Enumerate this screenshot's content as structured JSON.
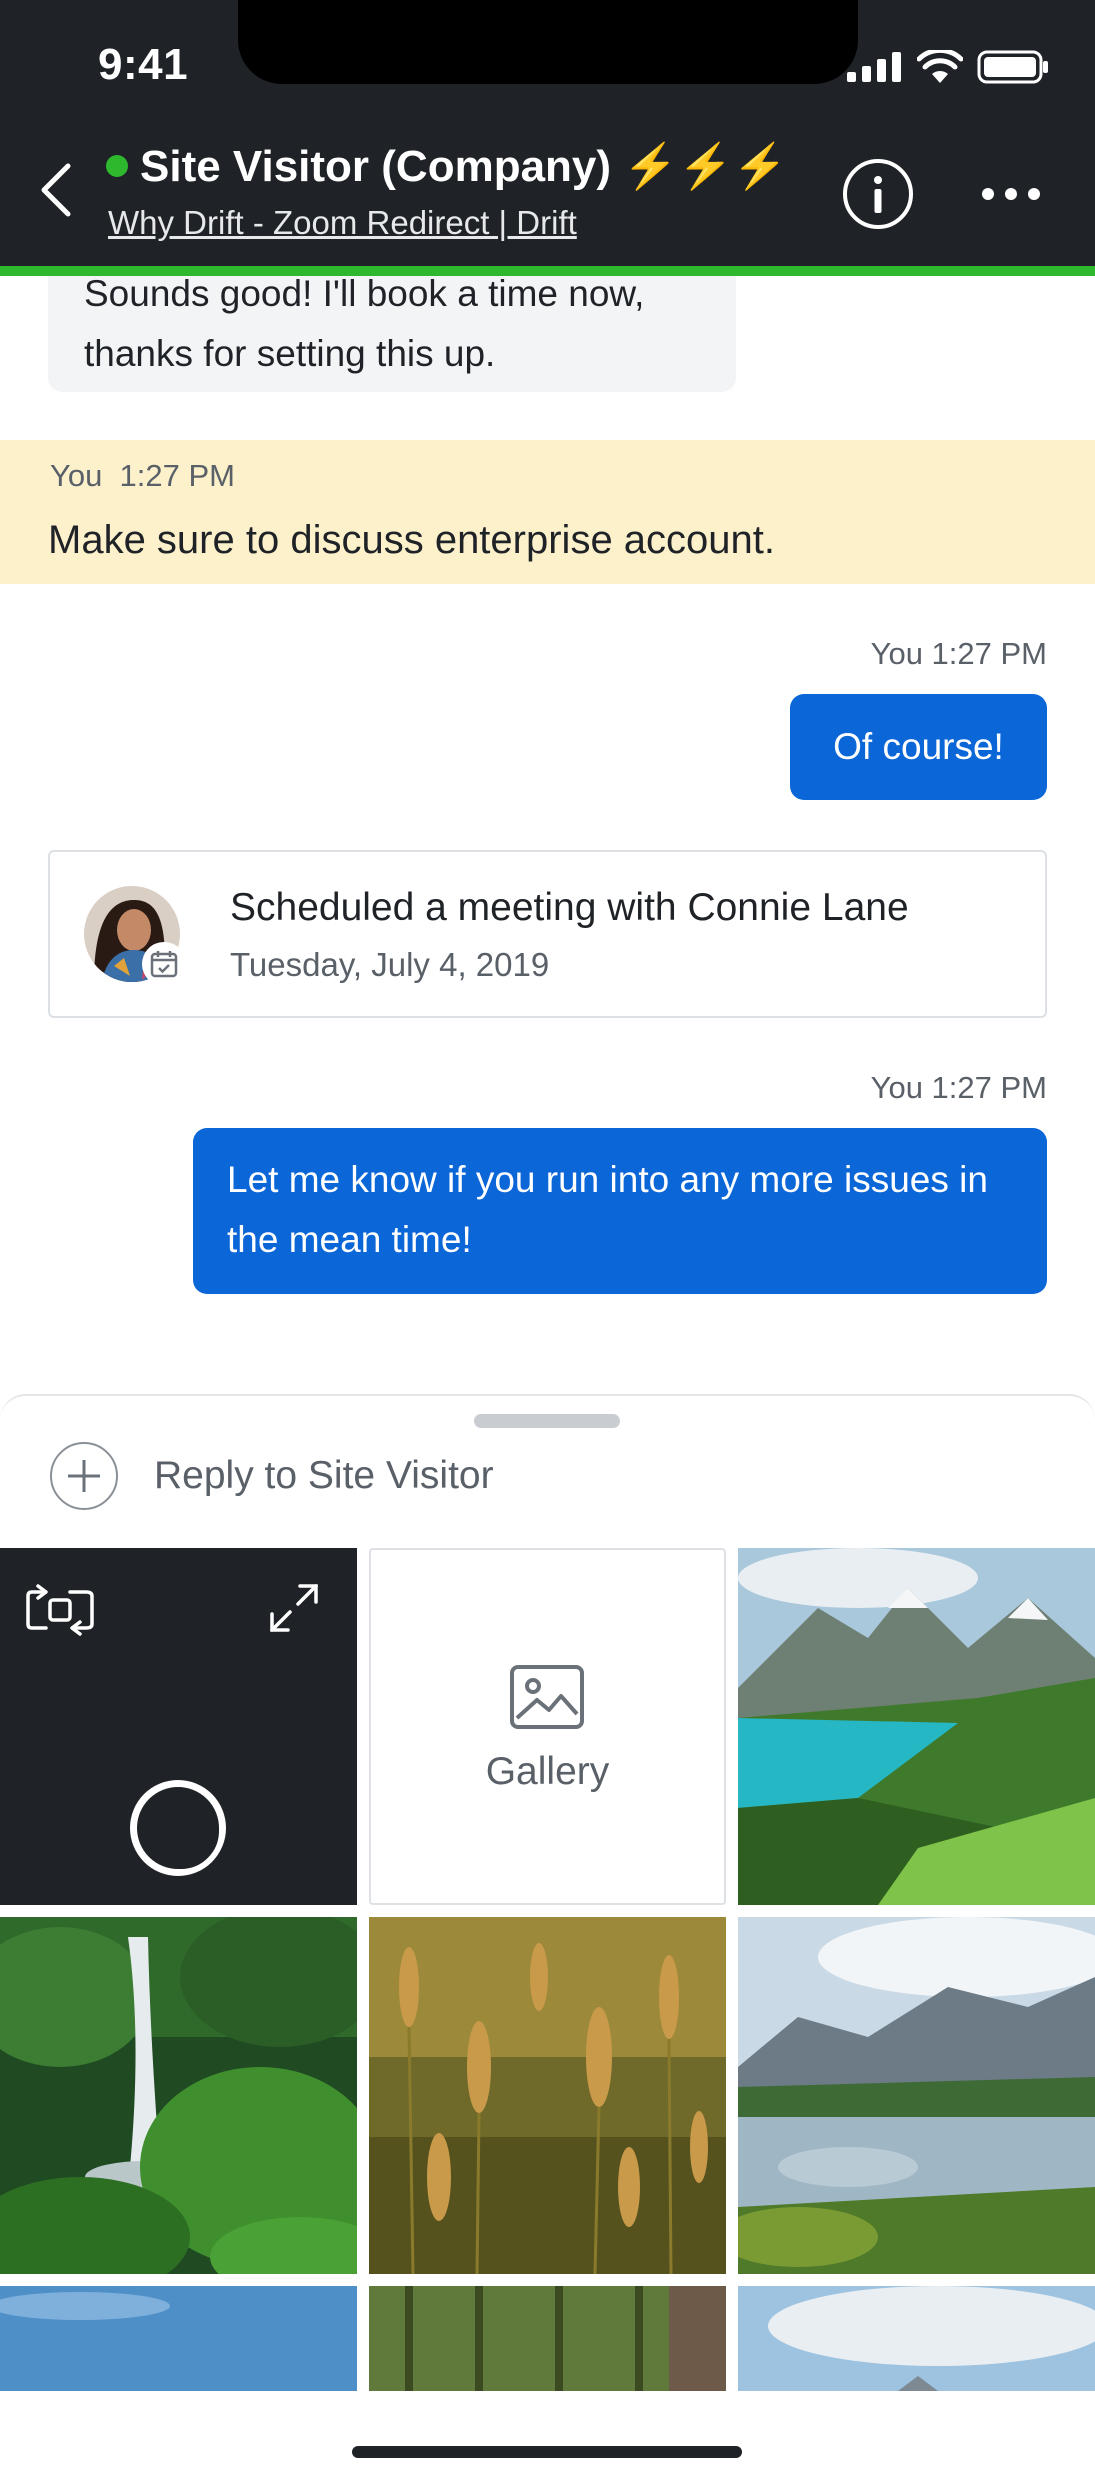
{
  "status_bar": {
    "time": "9:41"
  },
  "header": {
    "title": "Site Visitor (Company) ⚡⚡⚡",
    "subtitle": "Why Drift - Zoom Redirect | Drift",
    "online_color": "#2eb82e",
    "background_color": "#1f2327"
  },
  "messages": {
    "visitor_text": "Sounds good! I'll book a time now, thanks for setting this up.",
    "note": {
      "author": "You",
      "time": "1:27 PM",
      "text": "Make sure to discuss enterprise account."
    },
    "reply_1": {
      "meta": "You  1:27 PM",
      "text": "Of course!"
    },
    "meeting": {
      "title": "Scheduled a meeting with Connie Lane",
      "date": "Tuesday, July 4, 2019"
    },
    "reply_2": {
      "meta": "You  1:27 PM",
      "text": "Let me know if you run into any more issues in the mean time!"
    }
  },
  "composer": {
    "placeholder": "Reply to Site Visitor"
  },
  "media": {
    "gallery_label": "Gallery",
    "thumbnails": [
      "lake-mountains-photo",
      "waterfall-photo",
      "grass-field-photo",
      "mountain-pond-photo",
      "sky-photo",
      "forest-photo",
      "clouds-photo"
    ]
  },
  "colors": {
    "accent_blue": "#0b66d8",
    "note_yellow": "#fdf1cc",
    "green_stripe": "#2eb82e"
  }
}
